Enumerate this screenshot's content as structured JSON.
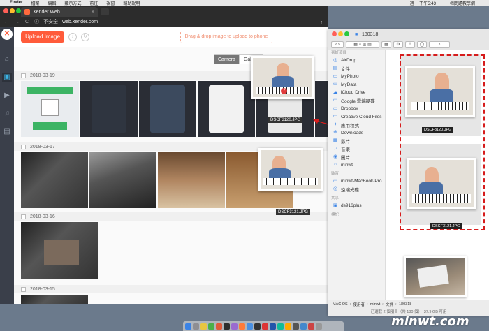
{
  "menubar": {
    "app_name": "Finder",
    "items": [
      "檔案",
      "編輯",
      "顯示方式",
      "前往",
      "視窗",
      "輔助說明"
    ],
    "clock": "週一 下午5:43",
    "user": "梅問題教學網"
  },
  "browser": {
    "tab_title": "Xender Web",
    "insecure_label": "不安全",
    "url": "web.xender.com"
  },
  "app": {
    "upload_button": "Upload Image",
    "dropzone_text": "Drag & drop image to upload to phone",
    "camera_tab": "Camera",
    "gallery_tab": "Gallery",
    "dates": [
      "2018-03-19",
      "2018-03-17",
      "2018-03-16",
      "2018-03-15"
    ],
    "drag_filenames": [
      "DSCF3120.JPG",
      "DSCF3121.JPG"
    ]
  },
  "finder": {
    "folder_name": "180318",
    "sections": {
      "favorites": "喜好項目",
      "devices": "裝置",
      "shared": "共享",
      "tags": "標記"
    },
    "favorites": [
      "AirDrop",
      "文件",
      "MyPhoto",
      "MyData",
      "iCloud Drive",
      "Google 雲端硬碟",
      "Dropbox",
      "Creative Cloud Files",
      "應用程式",
      "Downloads",
      "影片",
      "音樂",
      "圖片",
      "minwt"
    ],
    "devices": [
      "minwt-MacBook-Pro",
      "遠端光碟"
    ],
    "shared": [
      "ds916plus"
    ],
    "files": [
      "DSCF3120.JPG",
      "DSCF3121.JPG"
    ],
    "path": [
      "MAC OS",
      "使用者",
      "minwt",
      "文件",
      "180318"
    ],
    "status_info": "已選取 2 個項目（共 180 個），37.9 GB 可用"
  },
  "watermark": "minwt.com",
  "colors": {
    "accent": "#ff5b3a",
    "sidebar": "#3a3f4a",
    "highlight_dashed": "#d61c1c"
  }
}
